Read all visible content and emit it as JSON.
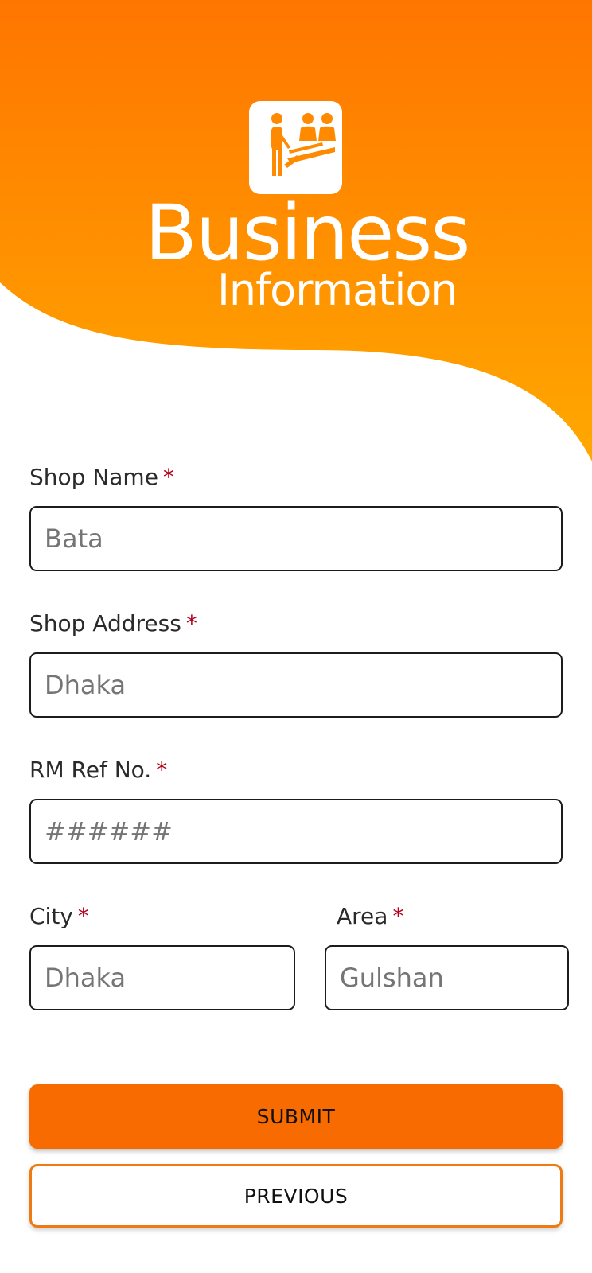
{
  "colors": {
    "header_top": "#ff7500",
    "header_bottom": "#ffa800",
    "required_star": "#b3001b",
    "submit_button": "#f76b00",
    "previous_border": "#ef7a14"
  },
  "header": {
    "icon": "business-meeting-icon",
    "title": "Business",
    "subtitle": "Information"
  },
  "form": {
    "required_mark": "*",
    "shop_name": {
      "label": "Shop Name",
      "placeholder": "Bata"
    },
    "shop_address": {
      "label": "Shop Address",
      "placeholder": "Dhaka"
    },
    "rm_ref": {
      "label": "RM Ref No.",
      "placeholder": "######"
    },
    "city": {
      "label": "City",
      "placeholder": "Dhaka"
    },
    "area": {
      "label": "Area",
      "placeholder": "Gulshan"
    }
  },
  "buttons": {
    "submit": "SUBMIT",
    "previous": "PREVIOUS"
  }
}
